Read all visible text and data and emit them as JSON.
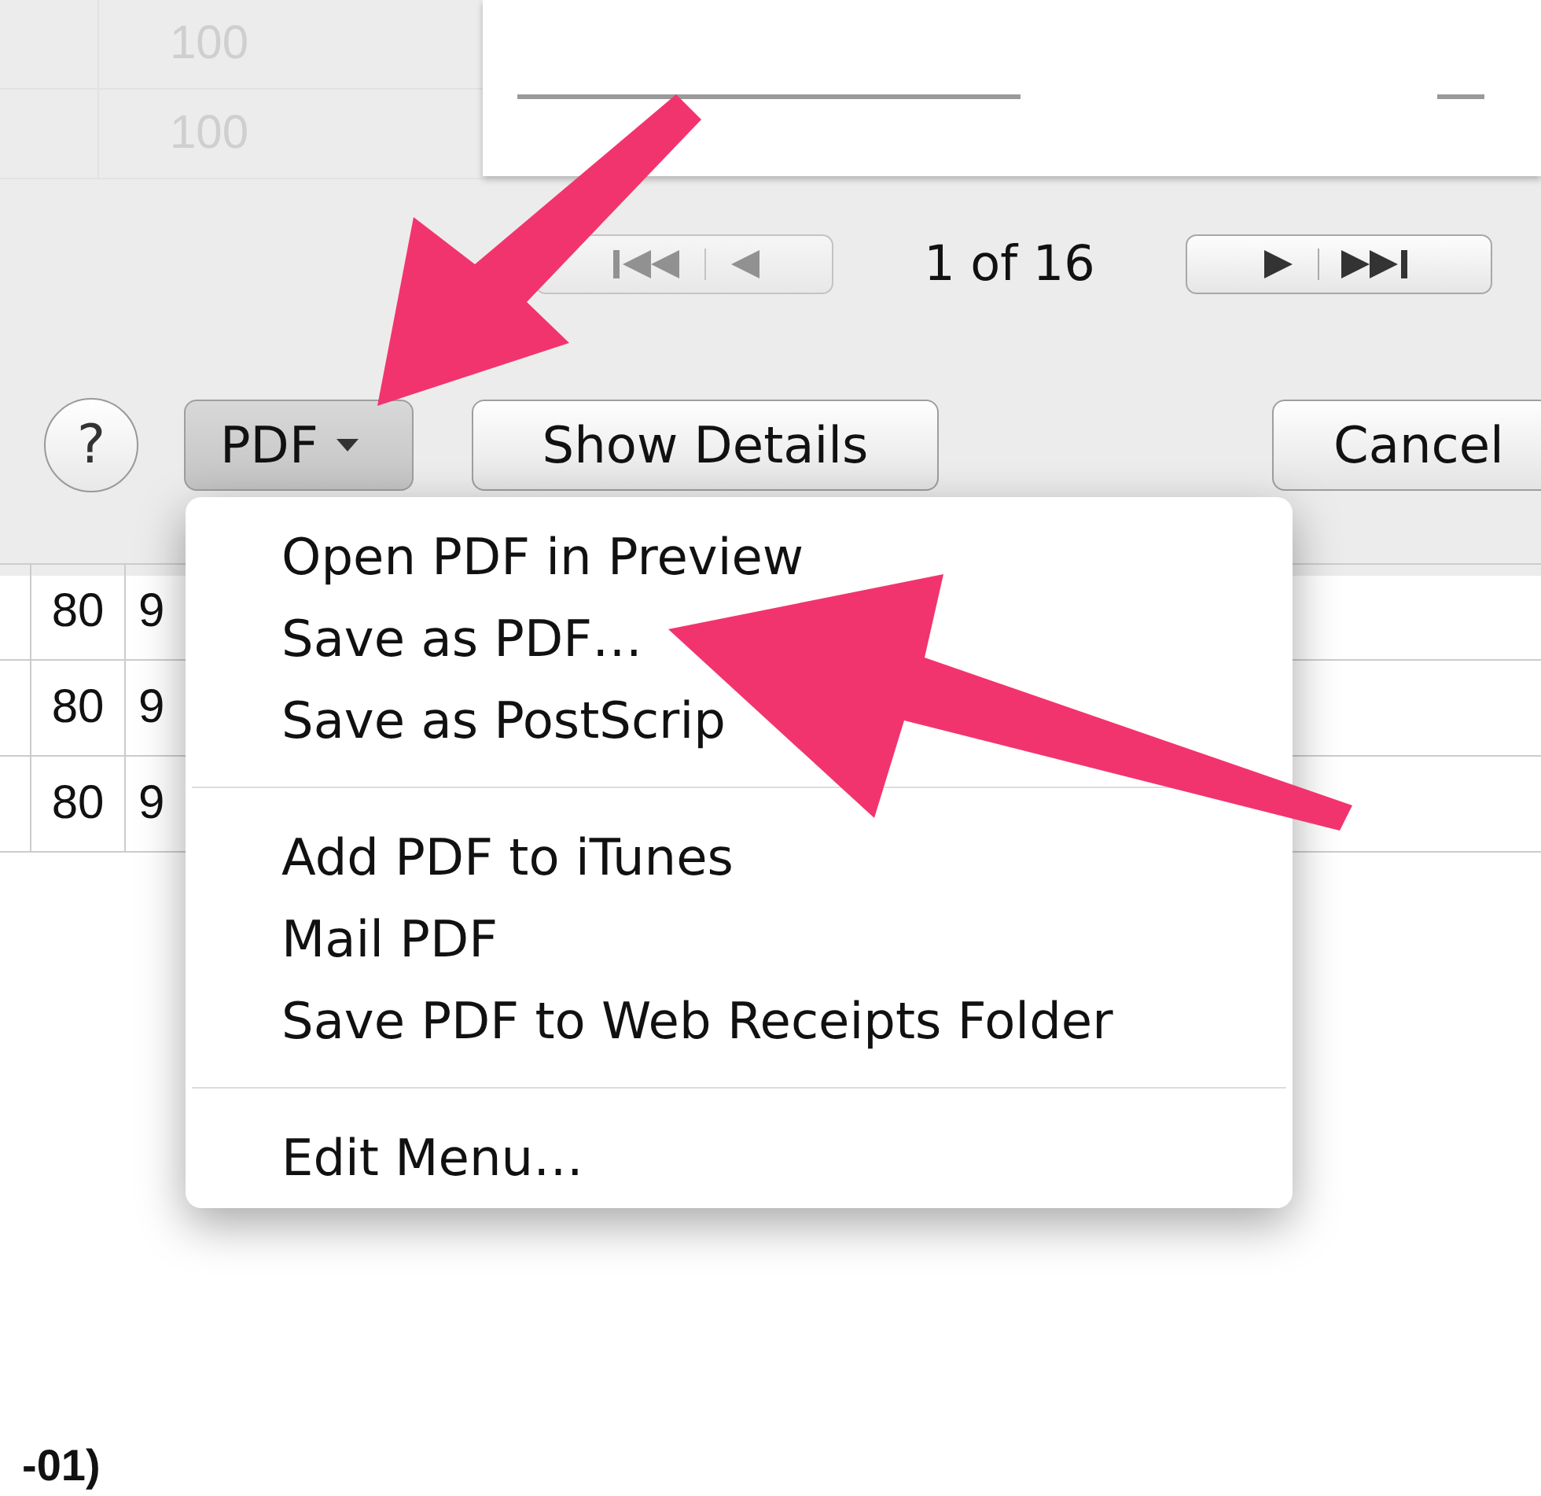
{
  "background_table": {
    "rows": [
      {
        "cells": [
          "100"
        ]
      },
      {
        "cells": [
          "100"
        ]
      }
    ]
  },
  "preview": {
    "page_indicator": "1 of 16"
  },
  "buttons": {
    "help": "?",
    "pdf": "PDF",
    "show_details": "Show Details",
    "cancel": "Cancel"
  },
  "pdf_menu": {
    "groups": [
      [
        "Open PDF in Preview",
        "Save as PDF…",
        "Save as PostScrip"
      ],
      [
        "Add PDF to iTunes",
        "Mail PDF",
        "Save PDF to Web Receipts Folder"
      ],
      [
        "Edit Menu…"
      ]
    ]
  },
  "document": {
    "rows": [
      {
        "col_2": "80",
        "col_3": "9"
      },
      {
        "col_2": "80",
        "col_3": "9"
      },
      {
        "col_2": "80",
        "col_3": "9"
      }
    ],
    "footer_text": "-01)"
  }
}
